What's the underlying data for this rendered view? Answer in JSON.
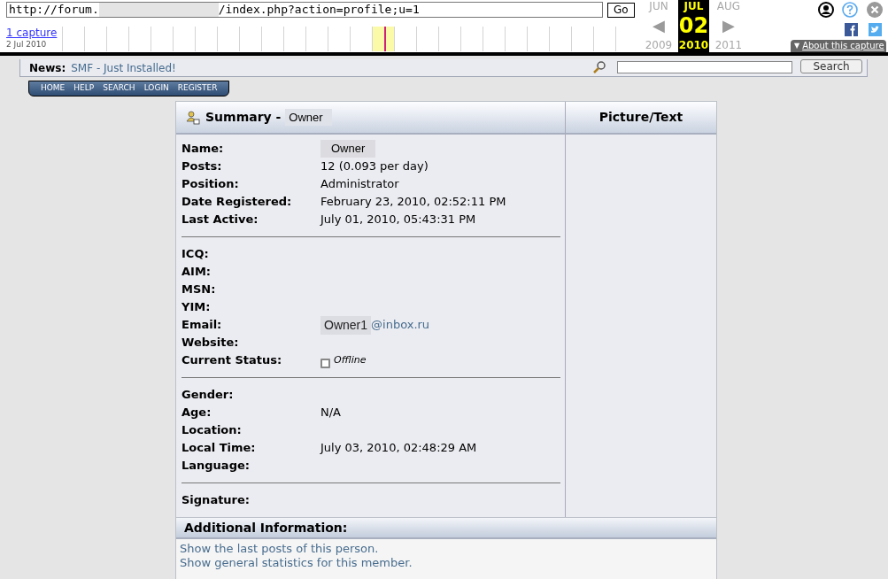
{
  "toolbar": {
    "url_start": "http://forum.",
    "url_end": "/index.php?action=profile;u=1",
    "go_button": "Go",
    "captures_link": "1 capture",
    "capture_date": "2 Jul 2010",
    "months": [
      {
        "month": "JUN",
        "arrow": "◀",
        "year": "2009",
        "selected": false
      },
      {
        "month": "JUL",
        "day": "02",
        "year": "2010",
        "selected": true
      },
      {
        "month": "AUG",
        "arrow": "▶",
        "year": "2011",
        "selected": false
      }
    ],
    "about_caret": "▼",
    "about_button": "About this capture"
  },
  "header": {
    "news_label": "News:",
    "news_text": "SMF - Just Installed!",
    "search_button": "Search"
  },
  "nav": [
    "HOME",
    "HELP",
    "SEARCH",
    "LOGIN",
    "REGISTER"
  ],
  "profile": {
    "title": "Summary - ",
    "title_name": "Owner",
    "side_title": "Picture/Text",
    "groups": [
      [
        {
          "label": "Name:",
          "value": "Owner",
          "kind": "masked"
        },
        {
          "label": "Posts:",
          "value": "12 (0.093 per day)",
          "kind": "text"
        },
        {
          "label": "Position:",
          "value": "Administrator",
          "kind": "text"
        },
        {
          "label": "Date Registered:",
          "value": "February 23, 2010, 02:52:11 PM",
          "kind": "text"
        },
        {
          "label": "Last Active:",
          "value": "July 01, 2010, 05:43:31 PM",
          "kind": "text"
        }
      ],
      [
        {
          "label": "ICQ:",
          "kind": "text"
        },
        {
          "label": "AIM:",
          "kind": "text"
        },
        {
          "label": "MSN:",
          "kind": "text"
        },
        {
          "label": "YIM:",
          "kind": "text"
        },
        {
          "label": "Email:",
          "value": "Owner1",
          "value_end": "@inbox.ru",
          "kind": "email"
        },
        {
          "label": "Website:",
          "kind": "text"
        },
        {
          "label": "Current Status:",
          "value": "Offline",
          "kind": "status"
        }
      ],
      [
        {
          "label": "Gender:",
          "kind": "text"
        },
        {
          "label": "Age:",
          "value": "N/A",
          "kind": "text"
        },
        {
          "label": "Location:",
          "kind": "text"
        },
        {
          "label": "Local Time:",
          "value": "July 03, 2010, 02:48:29 AM",
          "kind": "text"
        },
        {
          "label": "Language:",
          "kind": "text"
        }
      ],
      [
        {
          "label": "Signature:",
          "kind": "text"
        }
      ]
    ],
    "additional_title": "Additional Information:",
    "links": [
      "Show the last posts of this person.",
      "Show general statistics for this member."
    ]
  }
}
